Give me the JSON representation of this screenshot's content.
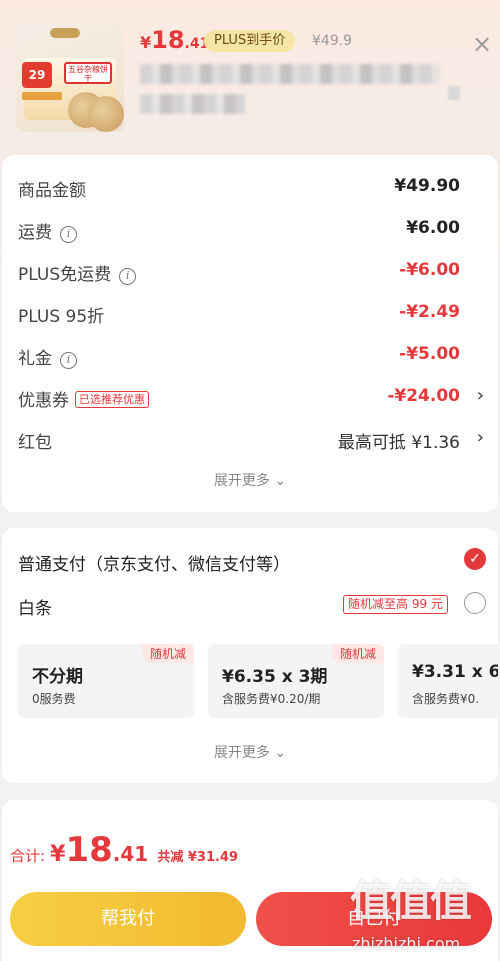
{
  "product": {
    "currency": "¥",
    "price_int": "18",
    "price_dec": ".41",
    "plus_tag": "PLUS到手价",
    "original_price": "¥49.9",
    "thumb_badge": "29",
    "thumb_label": "五谷杂粮饼干"
  },
  "amounts": [
    {
      "label": "商品金额",
      "value": "¥49.90",
      "info": false,
      "color": "dark"
    },
    {
      "label": "运费",
      "value": "¥6.00",
      "info": true,
      "color": "dark"
    },
    {
      "label": "PLUS免运费",
      "value": "-¥6.00",
      "info": true,
      "color": "red"
    },
    {
      "label": "PLUS 95折",
      "value": "-¥2.49",
      "info": false,
      "color": "red"
    },
    {
      "label": "礼金",
      "value": "-¥5.00",
      "info": true,
      "color": "red"
    },
    {
      "label": "优惠券",
      "tag": "已选推荐优惠",
      "value": "-¥24.00",
      "chevron": true,
      "color": "red"
    },
    {
      "label": "红包",
      "value": "最高可抵 ¥1.36",
      "chevron": true,
      "color": "normal"
    }
  ],
  "expand_more": "展开更多",
  "payment": {
    "normal_pay": "普通支付（京东支付、微信支付等）",
    "baitiao": "白条",
    "baitiao_promo": "随机减至高 99 元",
    "plans": [
      {
        "main": "不分期",
        "sub": "0服务费",
        "corner": "随机减"
      },
      {
        "main": "¥6.35 x 3期",
        "sub": "含服务费¥0.20/期",
        "corner": "随机减"
      },
      {
        "main": "¥3.31 x 6",
        "sub": "含服务费¥0.",
        "corner": ""
      }
    ],
    "expand_more": "展开更多"
  },
  "footer": {
    "total_label": "合计:",
    "currency": "¥",
    "total_int": "18",
    "total_dec": ".41",
    "saved": "共减 ¥31.49",
    "help_pay": "帮我付",
    "pay": "自己付"
  },
  "watermark": {
    "logo": "值值值",
    "url": "zhizhizhi.com"
  },
  "colors": {
    "accent_red": "#e4393c",
    "plus_gold": "#f5e6a6",
    "help_yellow": "#f2b92f"
  }
}
